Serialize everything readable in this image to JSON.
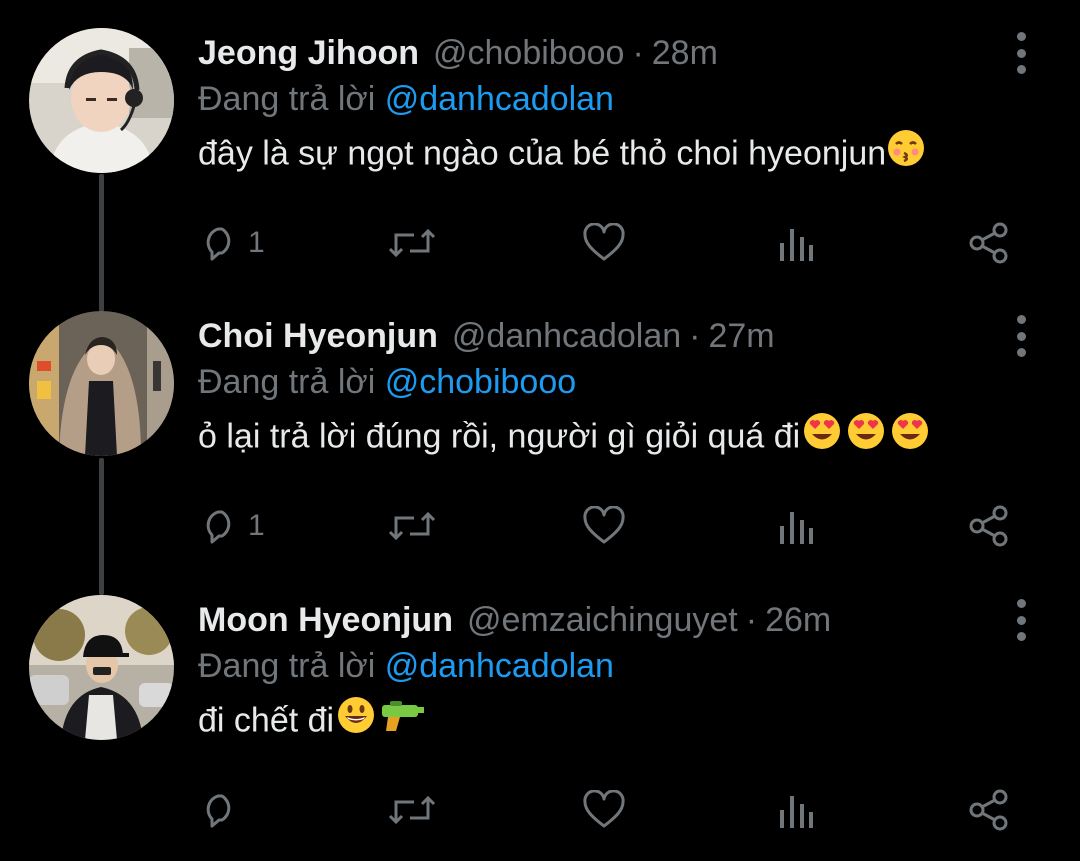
{
  "reply_prefix": "Đang trả lời",
  "tweets": [
    {
      "name": "Jeong Jihoon",
      "handle": "@chobibooo",
      "separator": "·",
      "time": "28m",
      "reply_to": "@danhcadolan",
      "text": "đây là sự ngọt ngào của bé thỏ choi hyeonjun",
      "emojis": [
        "kissing-face-closed-eyes"
      ],
      "reply_count": "1",
      "avatar_desc": "person-headset"
    },
    {
      "name": "Choi Hyeonjun",
      "handle": "@danhcadolan",
      "separator": "·",
      "time": "27m",
      "reply_to": "@chobibooo",
      "text": "ỏ lại trả lời đúng rồi, người gì giỏi quá đi",
      "emojis": [
        "heart-eyes",
        "heart-eyes",
        "heart-eyes"
      ],
      "reply_count": "1",
      "avatar_desc": "person-hooded-coat"
    },
    {
      "name": "Moon Hyeonjun",
      "handle": "@emzaichinguyet",
      "separator": "·",
      "time": "26m",
      "reply_to": "@danhcadolan",
      "text": "đi chết đi",
      "emojis": [
        "grinning-face",
        "water-pistol"
      ],
      "reply_count": "",
      "avatar_desc": "person-cap-outdoor"
    }
  ],
  "colors": {
    "background": "#000000",
    "primary_text": "#e7e9ea",
    "secondary_text": "#71767b",
    "link": "#1d9bf0",
    "thread_line": "#3d4144"
  }
}
